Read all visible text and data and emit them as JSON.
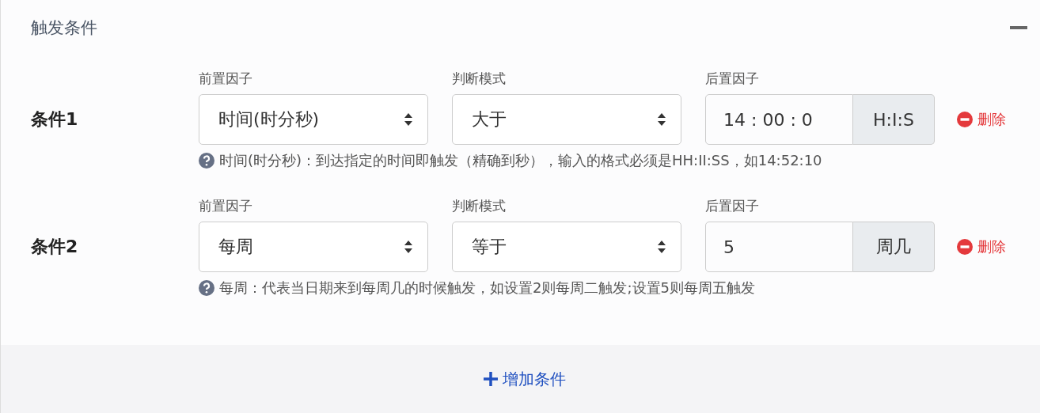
{
  "panel": {
    "title": "触发条件",
    "conditions": [
      {
        "label": "条件1",
        "fields": [
          {
            "kind": "select",
            "label": "前置因子",
            "value": "时间(时分秒)"
          },
          {
            "kind": "select",
            "label": "判断模式",
            "value": "大于"
          },
          {
            "kind": "addon",
            "label": "后置因子",
            "value": "14 : 00 : 0",
            "addon": "H:I:S"
          }
        ],
        "delete": "删除",
        "help": "时间(时分秒)：到达指定的时间即触发（精确到秒），输入的格式必须是HH:II:SS，如14:52:10"
      },
      {
        "label": "条件2",
        "fields": [
          {
            "kind": "select",
            "label": "前置因子",
            "value": "每周"
          },
          {
            "kind": "select",
            "label": "判断模式",
            "value": "等于"
          },
          {
            "kind": "addon",
            "label": "后置因子",
            "value": "5",
            "addon": "周几"
          }
        ],
        "delete": "删除",
        "help": "每周：代表当日期来到每周几的时候触发，如设置2则每周二触发;设置5则每周五触发"
      }
    ],
    "add_button": "增加条件"
  }
}
